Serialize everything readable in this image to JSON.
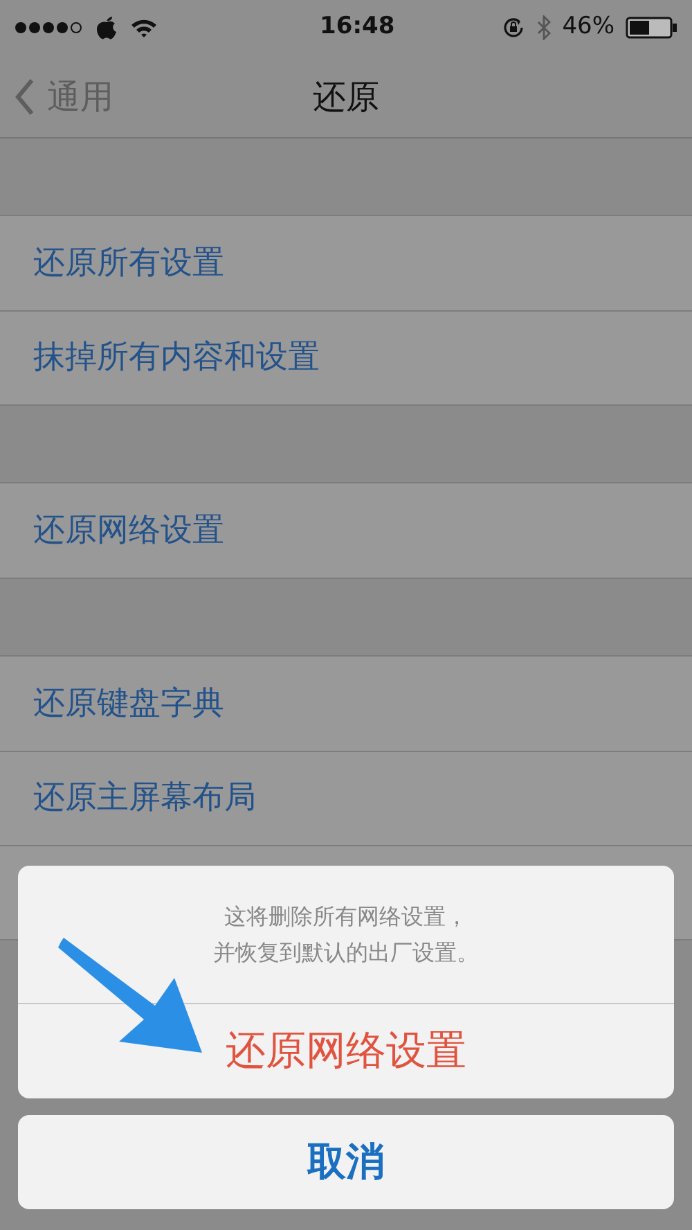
{
  "status_bar": {
    "time": "16:48",
    "battery": "46%"
  },
  "nav": {
    "back": "通用",
    "title": "还原"
  },
  "groups": [
    {
      "items": [
        "还原所有设置",
        "抹掉所有内容和设置"
      ]
    },
    {
      "items": [
        "还原网络设置"
      ]
    },
    {
      "items": [
        "还原键盘字典",
        "还原主屏幕布局"
      ]
    }
  ],
  "action_sheet": {
    "message": [
      "这将删除所有网络设置，",
      "并恢复到默认的出厂设置。"
    ],
    "actions": [
      {
        "label": "还原网络设置",
        "kind": "destructive"
      }
    ],
    "cancel": "取消"
  }
}
